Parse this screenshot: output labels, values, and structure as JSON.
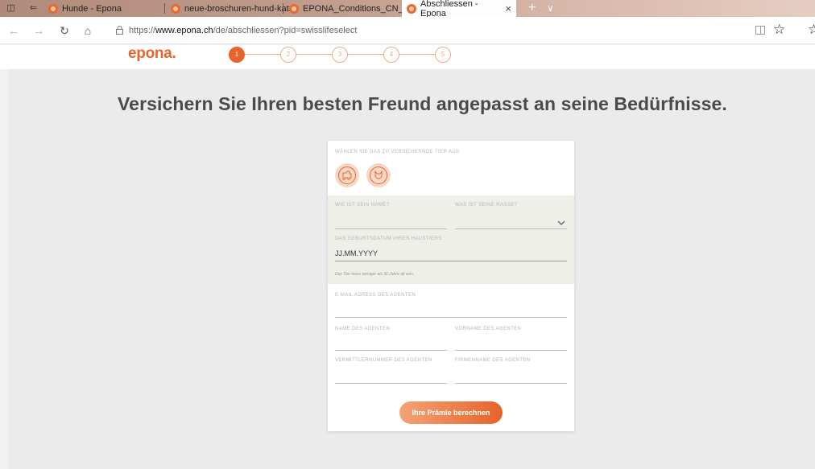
{
  "browser": {
    "tabs": [
      {
        "label": "Hunde - Epona",
        "active": false
      },
      {
        "label": "neue-broschuren-hund-katz",
        "active": false
      },
      {
        "label": "EPONA_Conditions_CN_CT_",
        "active": false
      },
      {
        "label": "Abschliessen - Epona",
        "active": true
      }
    ],
    "close_glyph": "×",
    "new_tab_glyph": "+",
    "tab_menu_glyph": "∨",
    "url_prefix": "https://",
    "url_domain": "www.epona.ch",
    "url_path": "/de/abschliessen?pid=swisslifeselect"
  },
  "site": {
    "logo": "epona.",
    "accent_color": "#e8642c",
    "steps": [
      "1",
      "2",
      "3",
      "4",
      "5"
    ],
    "active_step": "1",
    "headline": "Versichern Sie Ihren besten Freund angepasst an seine Bedürfnisse."
  },
  "form": {
    "animal_label": "WÄHLEN SIE DAS ZU VERSICHERNDE TIER AUS",
    "animals": [
      {
        "icon": "dog-icon"
      },
      {
        "icon": "cat-icon"
      }
    ],
    "pet_name_label": "WIE IST SEIN NAME?",
    "pet_name_value": "",
    "breed_label": "WAS IST SEINE RASSE?",
    "breed_value": "",
    "birthdate_label": "DAS GEBURTSDATUM IHRES HAUSTIERS",
    "birthdate_value": "JJ.MM.YYYY",
    "birthdate_hint": "Das Tier muss weniger als 30 Jahre alt sein.",
    "agent_email_label": "E-MAIL ADRESS DES AGENTEN",
    "agent_name_label": "NAME DES AGENTEN",
    "agent_firstname_label": "VORNAME DES AGENTEN",
    "agent_number_label": "VERMITTLERNUMMER DES AGENTEN",
    "agent_company_label": "FIRMENNAME DES AGENTEN",
    "submit_label": "Ihre Prämie berechnen"
  }
}
